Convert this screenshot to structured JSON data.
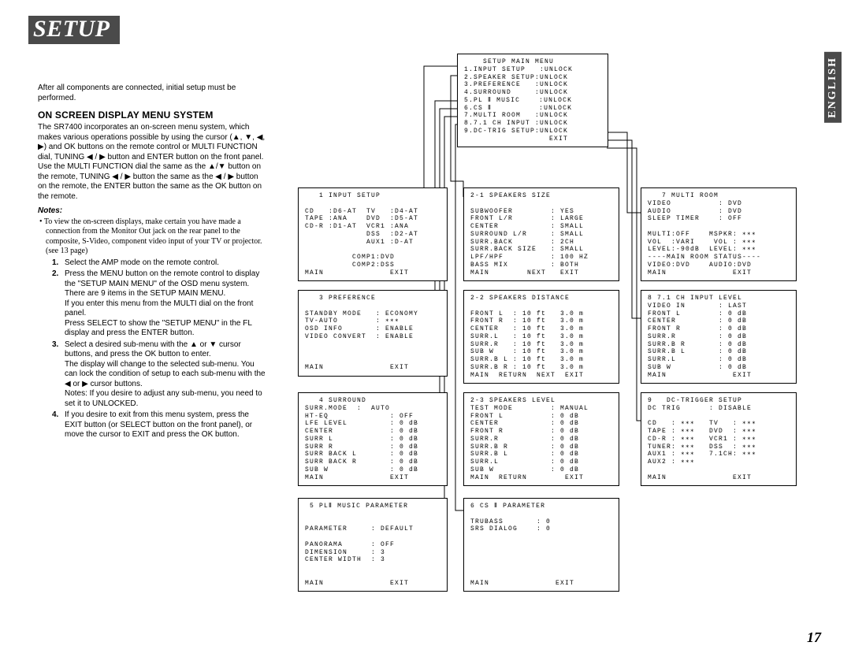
{
  "title": "SETUP",
  "side_tab": "ENGLISH",
  "page_num": "17",
  "intro": "After all components are connected, initial setup must be performed.",
  "subhead": "ON SCREEN DISPLAY MENU SYSTEM",
  "para1": "The SR7400 incorporates an on-screen menu system, which makes various operations possible by using the cursor (▲, ▼, ◀, ▶) and OK buttons on the remote control or MULTI FUNCTION dial, TUNING ◀ / ▶ button and ENTER button on the front panel. Use the MULTI FUNCTION dial the same as the ▲/▼ button on the remote, TUNING ◀ / ▶ button the same as the ◀ / ▶ button on the remote, the ENTER button the same as the OK button on the remote.",
  "notes_label": "Notes:",
  "bullet": "• To view the on-screen displays, make certain you have made a connection from the Monitor Out jack on the rear panel to the composite, S-Video, component video input of your TV or projector. (see 13 page)",
  "steps": {
    "s1": "Select the AMP mode on the remote control.",
    "s2": "Press the MENU button on the remote control to display the \"SETUP MAIN MENU\" of the OSD menu system. There are 9 items in the SETUP MAIN MENU.\nIf you enter this menu from the MULTI dial on the front panel.\nPress SELECT to show the \"SETUP MENU\" in the FL display and press the ENTER button.",
    "s3": "Select a desired sub-menu with the ▲ or ▼ cursor buttons, and press the OK button to enter.\nThe display will change to the selected sub-menu. You can lock the condition of setup to each sub-menu with the ◀ or ▶ cursor buttons.\nNotes: If you desire to adjust any sub-menu, you need to set it to UNLOCKED.",
    "s4": "If you desire to exit from this menu system, press the EXIT button (or SELECT button on the front panel), or move the cursor to EXIT and press the OK button."
  },
  "box_main": "    SETUP MAIN MENU\n1.INPUT SETUP   :UNLOCK\n2.SPEAKER SETUP:UNLOCK\n3.PREFERENCE   :UNLOCK\n4.SURROUND     :UNLOCK\n5.PL Ⅱ MUSIC    :UNLOCK\n6.CS Ⅱ          :UNLOCK\n7.MULTI ROOM   :UNLOCK\n8.7.1 CH INPUT :UNLOCK\n9.DC-TRIG SETUP:UNLOCK\n                  EXIT",
  "box_1": "   1 INPUT SETUP\n\nCD   :D6-AT  TV   :D4-AT\nTAPE :ANA    DVD  :D5-AT\nCD-R :D1-AT  VCR1 :ANA\n             DSS  :D2-AT\n             AUX1 :D-AT\n\n          COMP1:DVD\n          COMP2:DSS\nMAIN              EXIT",
  "box_3": "   3 PREFERENCE\n\nSTANDBY MODE   : ECONOMY\nTV-AUTO        : ∗∗∗\nOSD INFO       : ENABLE\nVIDEO CONVERT  : ENABLE\n\n\n\nMAIN              EXIT",
  "box_4": "   4 SURROUND\nSURR.MODE  :  AUTO\nHT-EQ             : OFF\nLFE LEVEL         : 0 dB\nCENTER            : 0 dB\nSURR L            : 0 dB\nSURR R            : 0 dB\nSURR BACK L       : 0 dB\nSURR BACK R       : 0 dB\nSUB W             : 0 dB\nMAIN              EXIT",
  "box_5": " 5 PLⅡ MUSIC PARAMETER\n\n\nPARAMETER     : DEFAULT\n\nPANORAMA      : OFF\nDIMENSION     : 3\nCENTER WIDTH  : 3\n\n\nMAIN              EXIT",
  "box_21": "2-1 SPEAKERS SIZE\n\nSUBWOOFER        : YES\nFRONT L/R        : LARGE\nCENTER           : SMALL\nSURROUND L/R     : SMALL\nSURR.BACK        : 2CH\nSURR.BACK SIZE   : SMALL\nLPF/HPF          : 100 HZ\nBASS MIX         : BOTH\nMAIN        NEXT   EXIT",
  "box_22": "2-2 SPEAKERS DISTANCE\n\nFRONT L  : 10 ft   3.0 m\nFRONT R  : 10 ft   3.0 m\nCENTER   : 10 ft   3.0 m\nSURR.L   : 10 ft   3.0 m\nSURR.R   : 10 ft   3.0 m\nSUB W    : 10 ft   3.0 m\nSURR.B L : 10 ft   3.0 m\nSURR.B R : 10 ft   3.0 m\nMAIN  RETURN  NEXT  EXIT",
  "box_23": "2-3 SPEAKERS LEVEL\nTEST MODE        : MANUAL\nFRONT L          : 0 dB\nCENTER           : 0 dB\nFRONT R          : 0 dB\nSURR.R           : 0 dB\nSURR.B R         : 0 dB\nSURR.B L         : 0 dB\nSURR.L           : 0 dB\nSUB W            : 0 dB\nMAIN  RETURN        EXIT",
  "box_6": "6 CS Ⅱ PARAMETER\n\nTRUBASS       : 0\nSRS DIALOG    : 0\n\n\n\n\n\n\nMAIN              EXIT",
  "box_7": "   7 MULTI ROOM\nVIDEO          : DVD\nAUDIO          : DVD\nSLEEP TIMER    : OFF\n\nMULTI:OFF    MSPKR: ∗∗∗\nVOL  :VARI    VOL : ∗∗∗\nLEVEL:-90dB  LEVEL: ∗∗∗\n----MAIN ROOM STATUS----\nVIDEO:DVD    AUDIO:DVD\nMAIN              EXIT",
  "box_8": "8 7.1 CH INPUT LEVEL\nVIDEO IN       : LAST\nFRONT L        : 0 dB\nCENTER         : 0 dB\nFRONT R        : 0 dB\nSURR.R         : 0 dB\nSURR.B R       : 0 dB\nSURR.B L       : 0 dB\nSURR.L         : 0 dB\nSUB W          : 0 dB\nMAIN              EXIT",
  "box_9": "9   DC-TRIGGER SETUP\nDC TRIG      : DISABLE\n\nCD   : ∗∗∗   TV   : ∗∗∗\nTAPE : ∗∗∗   DVD  : ∗∗∗\nCD-R : ∗∗∗   VCR1 : ∗∗∗\nTUNER: ∗∗∗   DSS  : ∗∗∗\nAUX1 : ∗∗∗   7.1CH: ∗∗∗\nAUX2 : ∗∗∗\n\nMAIN              EXIT"
}
